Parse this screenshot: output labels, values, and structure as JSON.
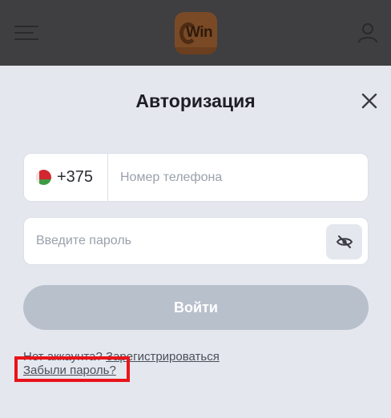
{
  "header": {
    "logo_text": "Win"
  },
  "auth": {
    "title": "Авторизация",
    "phone": {
      "country_code": "+375",
      "placeholder": "Номер телефона"
    },
    "password": {
      "placeholder": "Введите пароль"
    },
    "login_label": "Войти",
    "no_account_text": "Нет аккаунта?",
    "register_label": "Зарегистрироваться",
    "forgot_label": "Забыли пароль?"
  },
  "colors": {
    "header_bg": "#3f3f41",
    "page_bg": "#e4e7ee",
    "button_disabled": "#b8c0cc",
    "highlight": "#e8141a"
  },
  "icons": [
    "hamburger-menu-icon",
    "user-icon",
    "close-icon",
    "belarus-flag-icon",
    "eye-slash-icon"
  ]
}
